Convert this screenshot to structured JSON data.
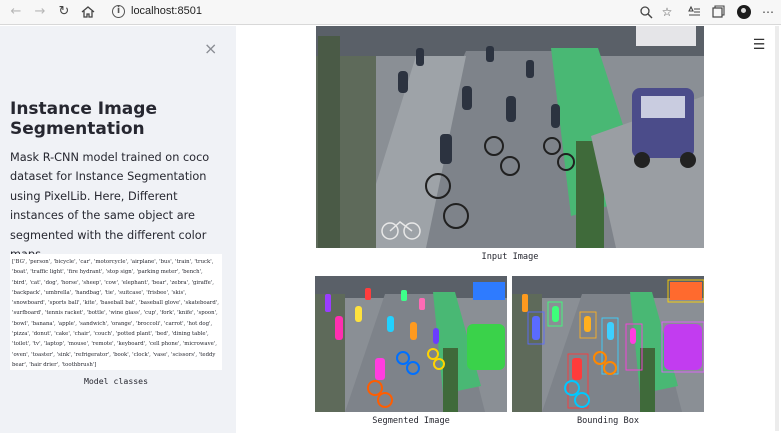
{
  "browser": {
    "url": "localhost:8501"
  },
  "sidebar": {
    "close_symbol": "×",
    "title": "Instance Image Segmentation",
    "description": "Mask R-CNN model trained on coco dataset for Instance Segmentation using PixelLib. Here, Different instances of the same object are segmented with the different color maps.",
    "classes_text": "['BG', 'person', 'bicycle', 'car', 'motorcycle', 'airplane', 'bus', 'train', 'truck', 'boat', 'traffic light', 'fire hydrant', 'stop sign', 'parking meter', 'bench', 'bird', 'cat', 'dog', 'horse', 'sheep', 'cow', 'elephant', 'bear', 'zebra', 'giraffe', 'backpack', 'umbrella', 'handbag', 'tie', 'suitcase', 'frisbee', 'skis', 'snowboard', 'sports ball', 'kite', 'baseball bat', 'baseball glove', 'skateboard', 'surfboard', 'tennis racket', 'bottle', 'wine glass', 'cup', 'fork', 'knife', 'spoon', 'bowl', 'banana', 'apple', 'sandwich', 'orange', 'broccoli', 'carrot', 'hot dog', 'pizza', 'donut', 'cake', 'chair', 'couch', 'potted plant', 'bed', 'dining table', 'toilet', 'tv', 'laptop', 'mouse', 'remote', 'keyboard', 'cell phone', 'microwave', 'oven', 'toaster', 'sink', 'refrigerator', 'book', 'clock', 'vase', 'scissors', 'teddy bear', 'hair drier', 'toothbrush']",
    "classes_caption": "Model classes"
  },
  "main": {
    "menu_symbol": "☰",
    "input_caption": "Input Image",
    "segmented_caption": "Segmented Image",
    "bbox_caption": "Bounding Box"
  },
  "icons": [
    "back-icon",
    "forward-icon",
    "reload-icon",
    "home-icon",
    "info-icon",
    "zoom-icon",
    "star-icon",
    "favorites-icon",
    "collections-icon",
    "profile-icon",
    "more-icon",
    "close-icon",
    "hamburger-icon"
  ],
  "colors": {
    "sidebar_bg": "#f0f2f6",
    "text": "#262730",
    "bike_lane": "#3fae6a",
    "road": "#8c9096"
  }
}
